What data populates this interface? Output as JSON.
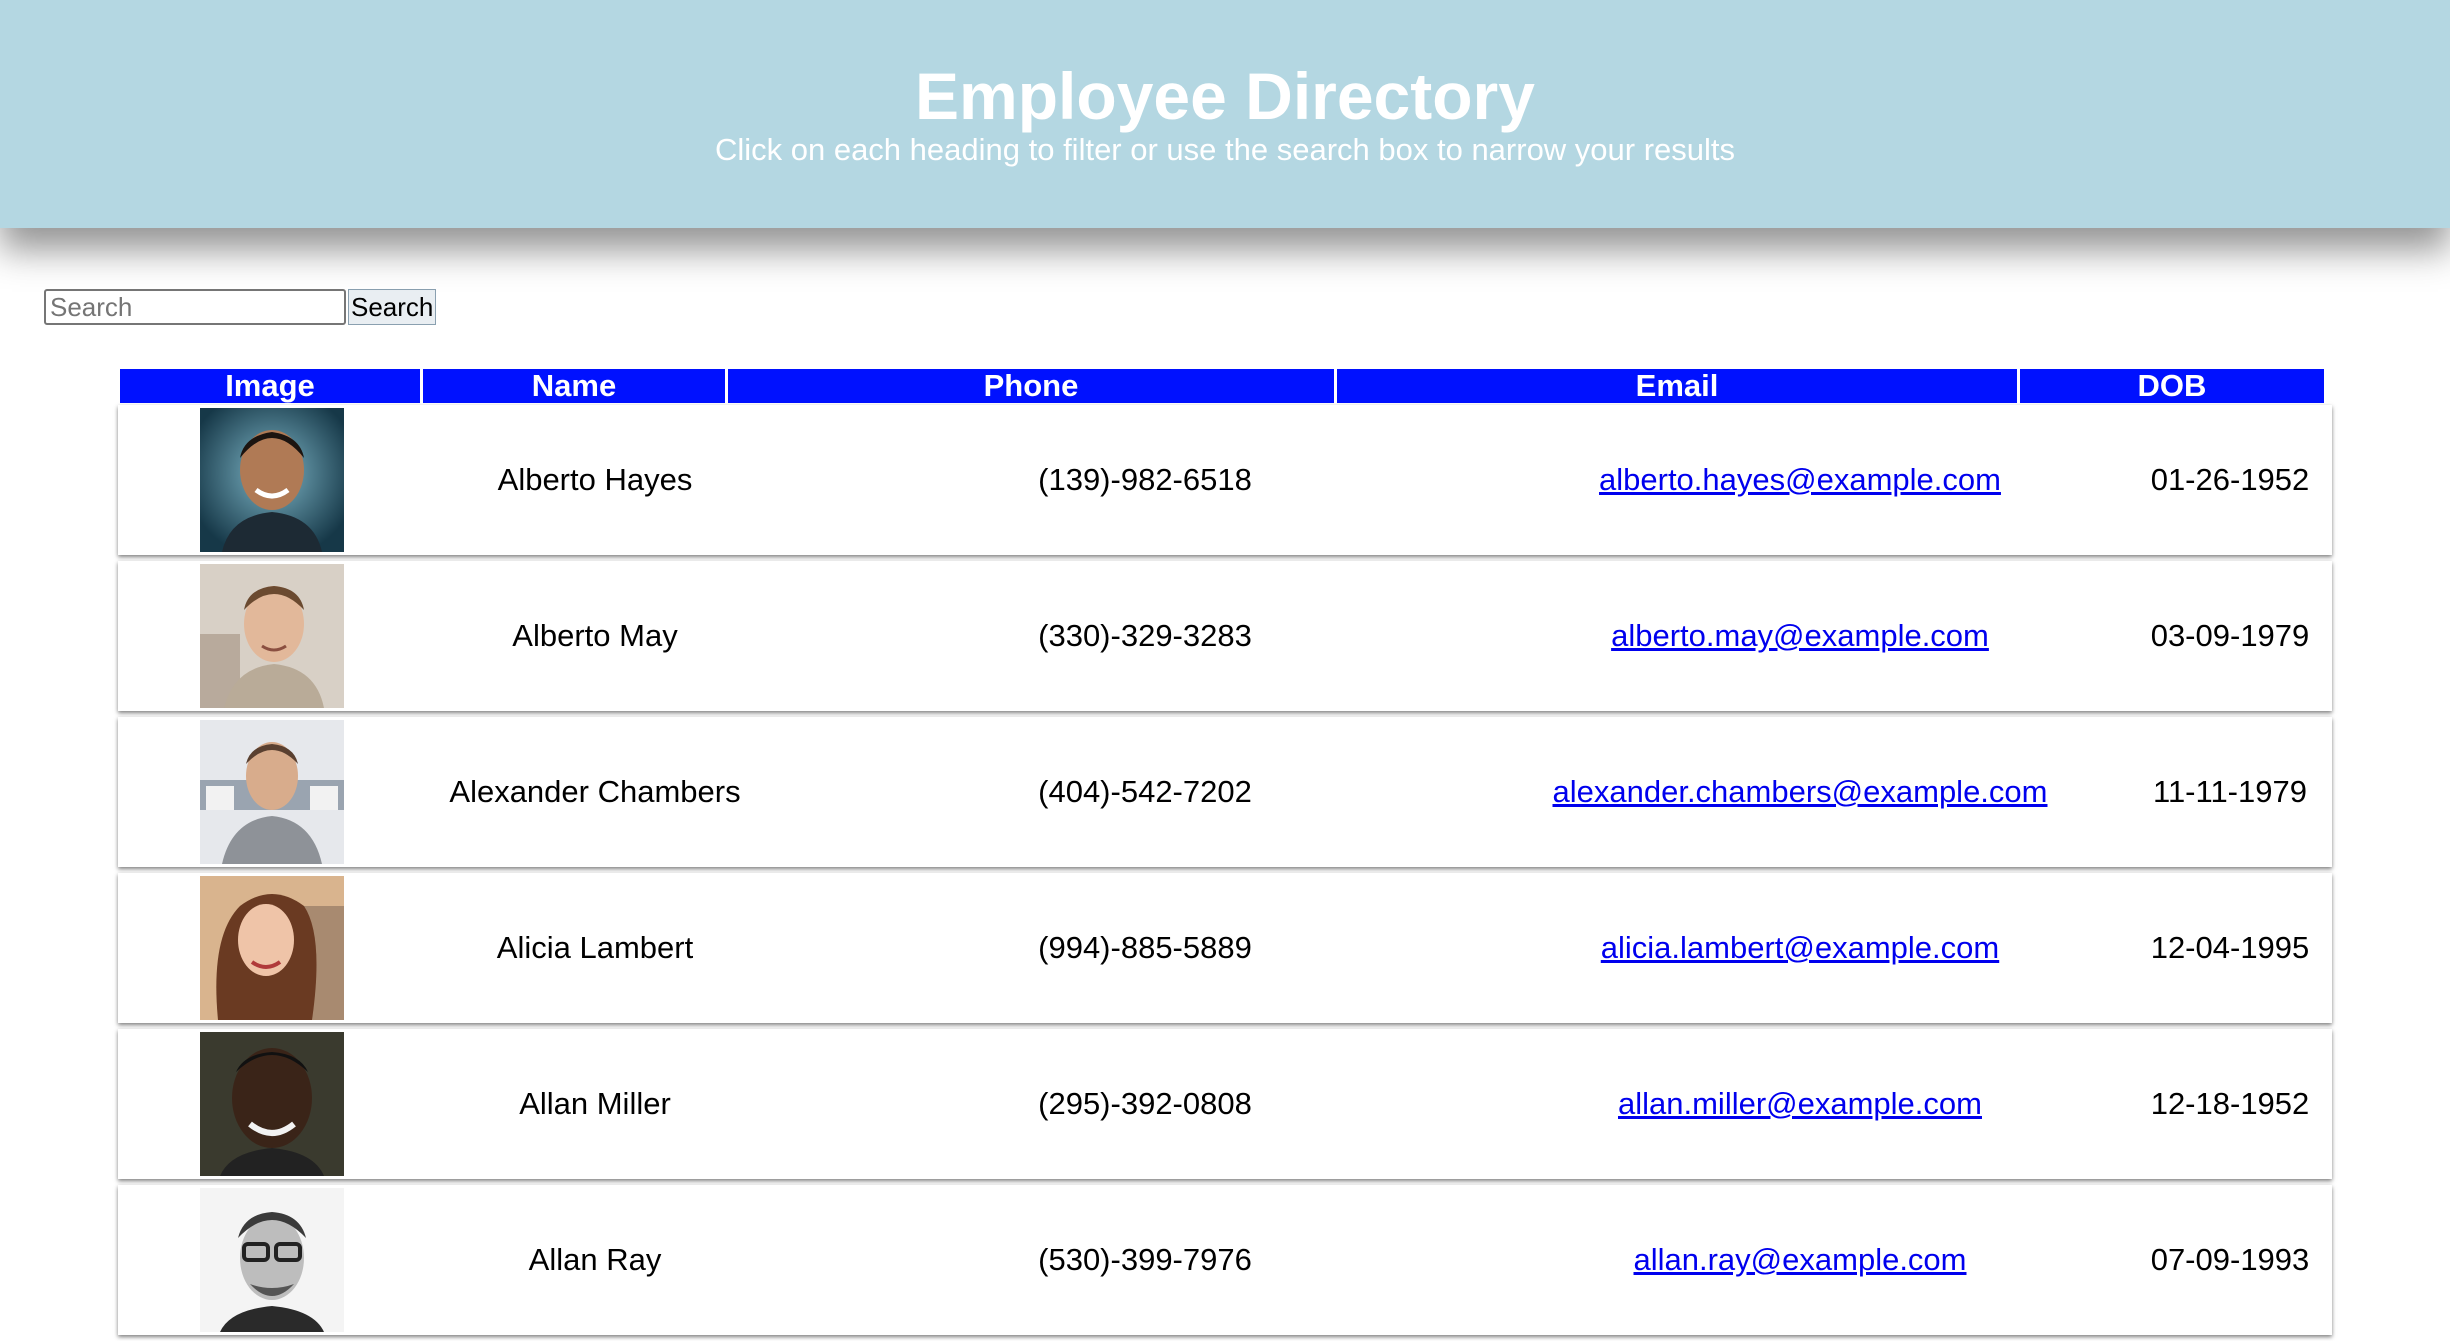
{
  "header": {
    "title": "Employee Directory",
    "subtitle": "Click on each heading to filter or use the search box to narrow your results"
  },
  "search": {
    "placeholder": "Search",
    "value": "",
    "button_label": "Search"
  },
  "table": {
    "columns": [
      "Image",
      "Name",
      "Phone",
      "Email",
      "DOB"
    ],
    "rows": [
      {
        "name": "Alberto Hayes",
        "phone": "(139)-982-6518",
        "email": "alberto.hayes@example.com",
        "dob": "01-26-1952"
      },
      {
        "name": "Alberto May",
        "phone": "(330)-329-3283",
        "email": "alberto.may@example.com",
        "dob": "03-09-1979"
      },
      {
        "name": "Alexander Chambers",
        "phone": "(404)-542-7202",
        "email": "alexander.chambers@example.com",
        "dob": "11-11-1979"
      },
      {
        "name": "Alicia Lambert",
        "phone": "(994)-885-5889",
        "email": "alicia.lambert@example.com",
        "dob": "12-04-1995"
      },
      {
        "name": "Allan Miller",
        "phone": "(295)-392-0808",
        "email": "allan.miller@example.com",
        "dob": "12-18-1952"
      },
      {
        "name": "Allan Ray",
        "phone": "(530)-399-7976",
        "email": "allan.ray@example.com",
        "dob": "07-09-1993"
      }
    ]
  },
  "colors": {
    "header_bg": "#b4d7e2",
    "table_header_bg": "#0011ff",
    "link": "#0000ee"
  }
}
